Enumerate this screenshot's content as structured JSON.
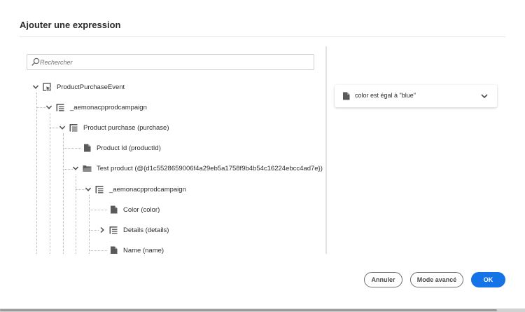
{
  "dialog": {
    "title": "Ajouter une expression"
  },
  "search": {
    "placeholder": "Rechercher"
  },
  "tree": {
    "nodes": [
      {
        "label": "ProductPurchaseEvent",
        "icon": "event-icon",
        "expanded": true
      },
      {
        "label": "_aemonacpprodcampaign",
        "icon": "object-icon",
        "expanded": true
      },
      {
        "label": "Product purchase (purchase)",
        "icon": "object-icon",
        "expanded": true
      },
      {
        "label": "Product Id (productId)",
        "icon": "field-icon"
      },
      {
        "label": "Test product (@{d1c5528659006f4a29eb5a1758f9b4b54c16224ebcc4ad7e})",
        "icon": "folder-icon",
        "expanded": true
      },
      {
        "label": "_aemonacpprodcampaign",
        "icon": "object-icon",
        "expanded": true
      },
      {
        "label": "Color (color)",
        "icon": "field-icon"
      },
      {
        "label": "Details (details)",
        "icon": "object-icon",
        "expanded": false
      },
      {
        "label": "Name (name)",
        "icon": "field-icon"
      }
    ]
  },
  "condition": {
    "text": "color est égal à \"blue\"",
    "icon": "field-icon",
    "toggle_icon": "chevron-down-icon"
  },
  "buttons": {
    "cancel": "Annuler",
    "advanced": "Mode avancé",
    "ok": "OK"
  },
  "colors": {
    "accent": "#1473e6",
    "text": "#2c2c2c",
    "icon": "#5a5a5a"
  }
}
